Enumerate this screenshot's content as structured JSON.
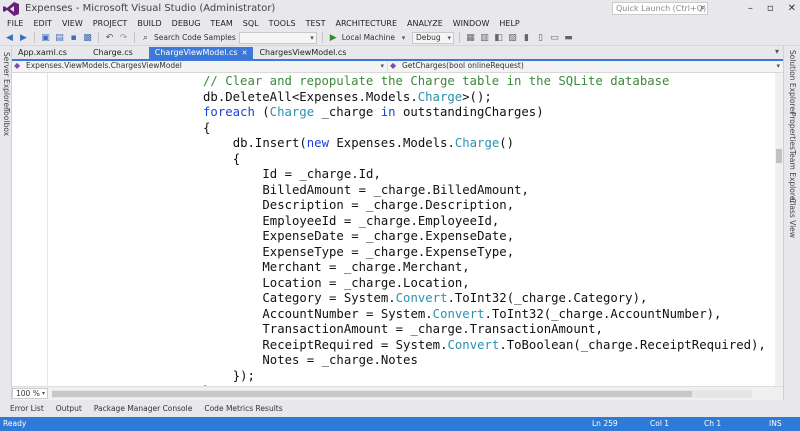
{
  "window": {
    "title": "Expenses - Microsoft Visual Studio (Administrator)",
    "quick_launch_placeholder": "Quick Launch (Ctrl+Q)"
  },
  "menu": [
    "FILE",
    "EDIT",
    "VIEW",
    "PROJECT",
    "BUILD",
    "DEBUG",
    "TEAM",
    "SQL",
    "TOOLS",
    "TEST",
    "ARCHITECTURE",
    "ANALYZE",
    "WINDOW",
    "HELP"
  ],
  "toolbar": {
    "search_label": "Search Code Samples",
    "run_target": "Local Machine",
    "configuration": "Debug"
  },
  "left_tabs": [
    "Server Explorer",
    "Toolbox"
  ],
  "right_tabs": [
    "Solution Explorer",
    "Properties",
    "Team Explorer",
    "Class View"
  ],
  "doc_tabs": [
    {
      "label": "App.xaml.cs",
      "active": false
    },
    {
      "label": "Charge.cs",
      "active": false
    },
    {
      "label": "ChargeViewModel.cs",
      "active": true
    },
    {
      "label": "ChargesViewModel.cs",
      "active": false
    }
  ],
  "navbar": {
    "type_combo": "Expenses.ViewModels.ChargesViewModel",
    "member_combo": "GetCharges(bool onlineRequest)"
  },
  "code_lines": [
    {
      "indent": 12,
      "parts": [
        {
          "t": "// Clear and repopulate the Charge table in the SQLite database",
          "c": "com"
        }
      ]
    },
    {
      "indent": 12,
      "parts": [
        {
          "t": "db.DeleteAll<Expenses.Models.",
          "c": ""
        },
        {
          "t": "Charge",
          "c": "type"
        },
        {
          "t": ">();",
          "c": ""
        }
      ]
    },
    {
      "indent": 12,
      "parts": [
        {
          "t": "foreach",
          "c": "kw"
        },
        {
          "t": " (",
          "c": ""
        },
        {
          "t": "Charge",
          "c": "type"
        },
        {
          "t": " _charge ",
          "c": ""
        },
        {
          "t": "in",
          "c": "kw"
        },
        {
          "t": " outstandingCharges)",
          "c": ""
        }
      ]
    },
    {
      "indent": 12,
      "parts": [
        {
          "t": "{",
          "c": ""
        }
      ]
    },
    {
      "indent": 16,
      "parts": [
        {
          "t": "db.Insert(",
          "c": ""
        },
        {
          "t": "new",
          "c": "kw"
        },
        {
          "t": " Expenses.Models.",
          "c": ""
        },
        {
          "t": "Charge",
          "c": "type"
        },
        {
          "t": "()",
          "c": ""
        }
      ]
    },
    {
      "indent": 16,
      "parts": [
        {
          "t": "{",
          "c": ""
        }
      ]
    },
    {
      "indent": 20,
      "parts": [
        {
          "t": "Id = _charge.Id,",
          "c": ""
        }
      ]
    },
    {
      "indent": 20,
      "parts": [
        {
          "t": "BilledAmount = _charge.BilledAmount,",
          "c": ""
        }
      ]
    },
    {
      "indent": 20,
      "parts": [
        {
          "t": "Description = _charge.Description,",
          "c": ""
        }
      ]
    },
    {
      "indent": 20,
      "parts": [
        {
          "t": "EmployeeId = _charge.EmployeeId,",
          "c": ""
        }
      ]
    },
    {
      "indent": 20,
      "parts": [
        {
          "t": "ExpenseDate = _charge.ExpenseDate,",
          "c": ""
        }
      ]
    },
    {
      "indent": 20,
      "parts": [
        {
          "t": "ExpenseType = _charge.ExpenseType,",
          "c": ""
        }
      ]
    },
    {
      "indent": 20,
      "parts": [
        {
          "t": "Merchant = _charge.Merchant,",
          "c": ""
        }
      ]
    },
    {
      "indent": 20,
      "parts": [
        {
          "t": "Location = _charge.Location,",
          "c": ""
        }
      ]
    },
    {
      "indent": 20,
      "parts": [
        {
          "t": "Category = System.",
          "c": ""
        },
        {
          "t": "Convert",
          "c": "type"
        },
        {
          "t": ".ToInt32(_charge.Category),",
          "c": ""
        }
      ]
    },
    {
      "indent": 20,
      "parts": [
        {
          "t": "AccountNumber = System.",
          "c": ""
        },
        {
          "t": "Convert",
          "c": "type"
        },
        {
          "t": ".ToInt32(_charge.AccountNumber),",
          "c": ""
        }
      ]
    },
    {
      "indent": 20,
      "parts": [
        {
          "t": "TransactionAmount = _charge.TransactionAmount,",
          "c": ""
        }
      ]
    },
    {
      "indent": 20,
      "parts": [
        {
          "t": "ReceiptRequired = System.",
          "c": ""
        },
        {
          "t": "Convert",
          "c": "type"
        },
        {
          "t": ".ToBoolean(_charge.ReceiptRequired),",
          "c": ""
        }
      ]
    },
    {
      "indent": 20,
      "parts": [
        {
          "t": "Notes = _charge.Notes",
          "c": ""
        }
      ]
    },
    {
      "indent": 16,
      "parts": [
        {
          "t": "});",
          "c": ""
        }
      ]
    },
    {
      "indent": 12,
      "parts": [
        {
          "t": "}",
          "c": ""
        }
      ]
    },
    {
      "indent": 8,
      "parts": [
        {
          "t": "}",
          "c": ""
        }
      ]
    },
    {
      "indent": 4,
      "parts": [
        {
          "t": "}",
          "c": ""
        }
      ]
    }
  ],
  "editor": {
    "zoom": "100 %"
  },
  "tool_tabs": [
    "Error List",
    "Output",
    "Package Manager Console",
    "Code Metrics Results"
  ],
  "status": {
    "left": "Ready",
    "line": "Ln 259",
    "col": "Col 1",
    "ch": "Ch 1",
    "mode": "INS"
  },
  "colors": {
    "accent": "#3b78d8",
    "status_bar": "#2f7ad6",
    "keyword": "#1e3fd6",
    "type": "#2b91af",
    "comment": "#3a8a3a"
  }
}
